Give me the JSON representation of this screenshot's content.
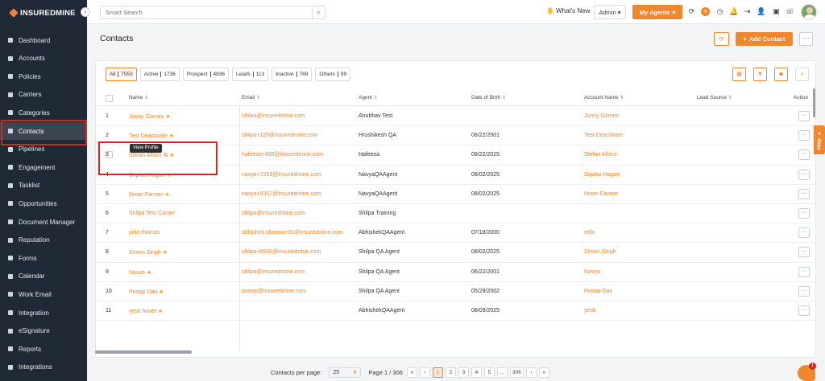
{
  "app": {
    "logo_text": "INSUREDMINE"
  },
  "sidebar": {
    "items": [
      {
        "label": "Dashboard",
        "icon": "grid-icon"
      },
      {
        "label": "Accounts",
        "icon": "users-icon"
      },
      {
        "label": "Policies",
        "icon": "document-icon"
      },
      {
        "label": "Carriers",
        "icon": "folder-icon"
      },
      {
        "label": "Categories",
        "icon": "layers-icon"
      },
      {
        "label": "Contacts",
        "icon": "contact-card-icon",
        "active": true
      },
      {
        "label": "Pipelines",
        "icon": "funnel-icon"
      },
      {
        "label": "Engagement",
        "icon": "megaphone-icon"
      },
      {
        "label": "Tasklist",
        "icon": "checklist-icon"
      },
      {
        "label": "Opportunities",
        "icon": "people-icon"
      },
      {
        "label": "Document Manager",
        "icon": "folder-open-icon"
      },
      {
        "label": "Reputation",
        "icon": "star-group-icon"
      },
      {
        "label": "Forms",
        "icon": "form-icon"
      },
      {
        "label": "Calendar",
        "icon": "calendar-icon"
      },
      {
        "label": "Work Email",
        "icon": "mail-icon"
      },
      {
        "label": "Integration",
        "icon": "plug-icon"
      },
      {
        "label": "eSignature",
        "icon": "pen-icon"
      },
      {
        "label": "Reports",
        "icon": "chart-icon"
      },
      {
        "label": "Integrations",
        "icon": "gears-icon"
      }
    ]
  },
  "topbar": {
    "search_placeholder": "Smart Search",
    "whats_new": "What's New",
    "admin_label": "Admin",
    "my_agents_label": "My Agents"
  },
  "header": {
    "title": "Contacts",
    "add_contact_label": "Add Contact",
    "more_label": "···"
  },
  "filters": [
    {
      "label": "All",
      "count": "7553",
      "active": true
    },
    {
      "label": "Active",
      "count": "1736"
    },
    {
      "label": "Prospect",
      "count": "4836"
    },
    {
      "label": "Leads",
      "count": "113"
    },
    {
      "label": "Inactive",
      "count": "769"
    },
    {
      "label": "Others",
      "count": "99"
    }
  ],
  "table": {
    "columns": [
      "Name",
      "Email",
      "Agent",
      "Date of Birth",
      "Account Name",
      "Lead Source",
      "Action"
    ],
    "rows": [
      {
        "num": "1",
        "name": "Jonny Gomes",
        "star": true,
        "email": "shilpa@insuredmine.com",
        "agent": "Anubhav Test",
        "dob": "",
        "account": "Jonny Gomes"
      },
      {
        "num": "2",
        "name": "Test Deactivate",
        "star": true,
        "email": "shilpa+120@insuredmine.com",
        "agent": "Hrushikesh QA",
        "dob": "06/22/2001",
        "account": "Test Deactivate"
      },
      {
        "num": "3",
        "name": "Stefan Alfaro",
        "star": true,
        "ext": true,
        "email": "hafeeza+699@insuredmine.com",
        "agent": "Hafeeza",
        "dob": "08/22/2025",
        "account": "Stefan Alfaro"
      },
      {
        "num": "4",
        "name": "Sophia Hogan",
        "star": true,
        "email": "navya+7259@insuredmine.com",
        "agent": "NavyaQAAgent",
        "dob": "08/02/2025",
        "account": "Sophia Hogan"
      },
      {
        "num": "5",
        "name": "Nixon Farmer",
        "star": true,
        "email": "navya+9352@insuredmine.com",
        "agent": "NavyaQAAgent",
        "dob": "08/02/2025",
        "account": "Nixon Farmer"
      },
      {
        "num": "6",
        "name": "Shilpa Test Carrier",
        "star": false,
        "email": "shilpa@insuredmine.com",
        "agent": "Shilpa Training",
        "dob": "",
        "account": ""
      },
      {
        "num": "7",
        "name": "john thomas",
        "star": false,
        "email": "abhishek.sharma+01@insuredmine.com",
        "agent": "AbhishekQAAgent",
        "dob": "07/18/2000",
        "account": "rello"
      },
      {
        "num": "8",
        "name": "Simon Singh",
        "star": true,
        "email": "shilpa+6698@insuredmine.com",
        "agent": "Shilpa QA Agent",
        "dob": "08/02/2025",
        "account": "Simon Singh"
      },
      {
        "num": "9",
        "name": "Navya",
        "star": true,
        "email": "shilpa@insuredmine.com",
        "agent": "Shilpa QA Agent",
        "dob": "06/22/2001",
        "account": "Navya"
      },
      {
        "num": "10",
        "name": "Pratap Das",
        "star": true,
        "email": "pratap@insuredmine.com",
        "agent": "Shilpa QA Agent",
        "dob": "05/29/2002",
        "account": "Pratap Das"
      },
      {
        "num": "11",
        "name": "yesti hover",
        "star": true,
        "email": "",
        "agent": "AbhishekQAAgent",
        "dob": "08/09/2025",
        "account": "yesti"
      }
    ],
    "action_label": "···"
  },
  "tooltip": {
    "text": "View Profile"
  },
  "help_tab": {
    "label": "Help"
  },
  "pagination": {
    "per_page_label": "Contacts per page:",
    "per_page_value": "25",
    "page_info": "Page 1 / 306",
    "buttons": [
      "«",
      "‹",
      "1",
      "2",
      "3",
      "4",
      "5",
      "...",
      "306",
      "›",
      "»"
    ],
    "active": "1"
  },
  "chat": {
    "badge": "1"
  },
  "colors": {
    "accent": "#f0862e",
    "sidebar_bg": "#1f2a36",
    "highlight": "#d9261c"
  }
}
